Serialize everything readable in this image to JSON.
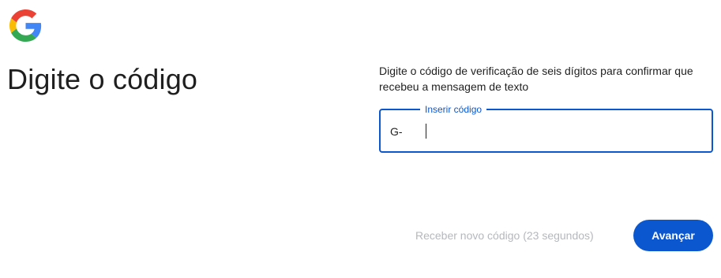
{
  "logo": {
    "icon": "google-g-logo-icon"
  },
  "heading": {
    "title": "Digite o código"
  },
  "instructions": {
    "text": "Digite o código de verificação de seis dígitos para confirmar que recebeu a mensagem de texto"
  },
  "code_field": {
    "label": "Inserir código",
    "prefix": "G-",
    "value": ""
  },
  "actions": {
    "resend_label": "Receber novo código (23 segundos)",
    "next_label": "Avançar"
  },
  "colors": {
    "accent": "#0b57d0",
    "text": "#1f1f1f",
    "disabled": "#b4b8bd",
    "google_blue": "#4285F4",
    "google_red": "#EA4335",
    "google_yellow": "#FBBC05",
    "google_green": "#34A853"
  }
}
